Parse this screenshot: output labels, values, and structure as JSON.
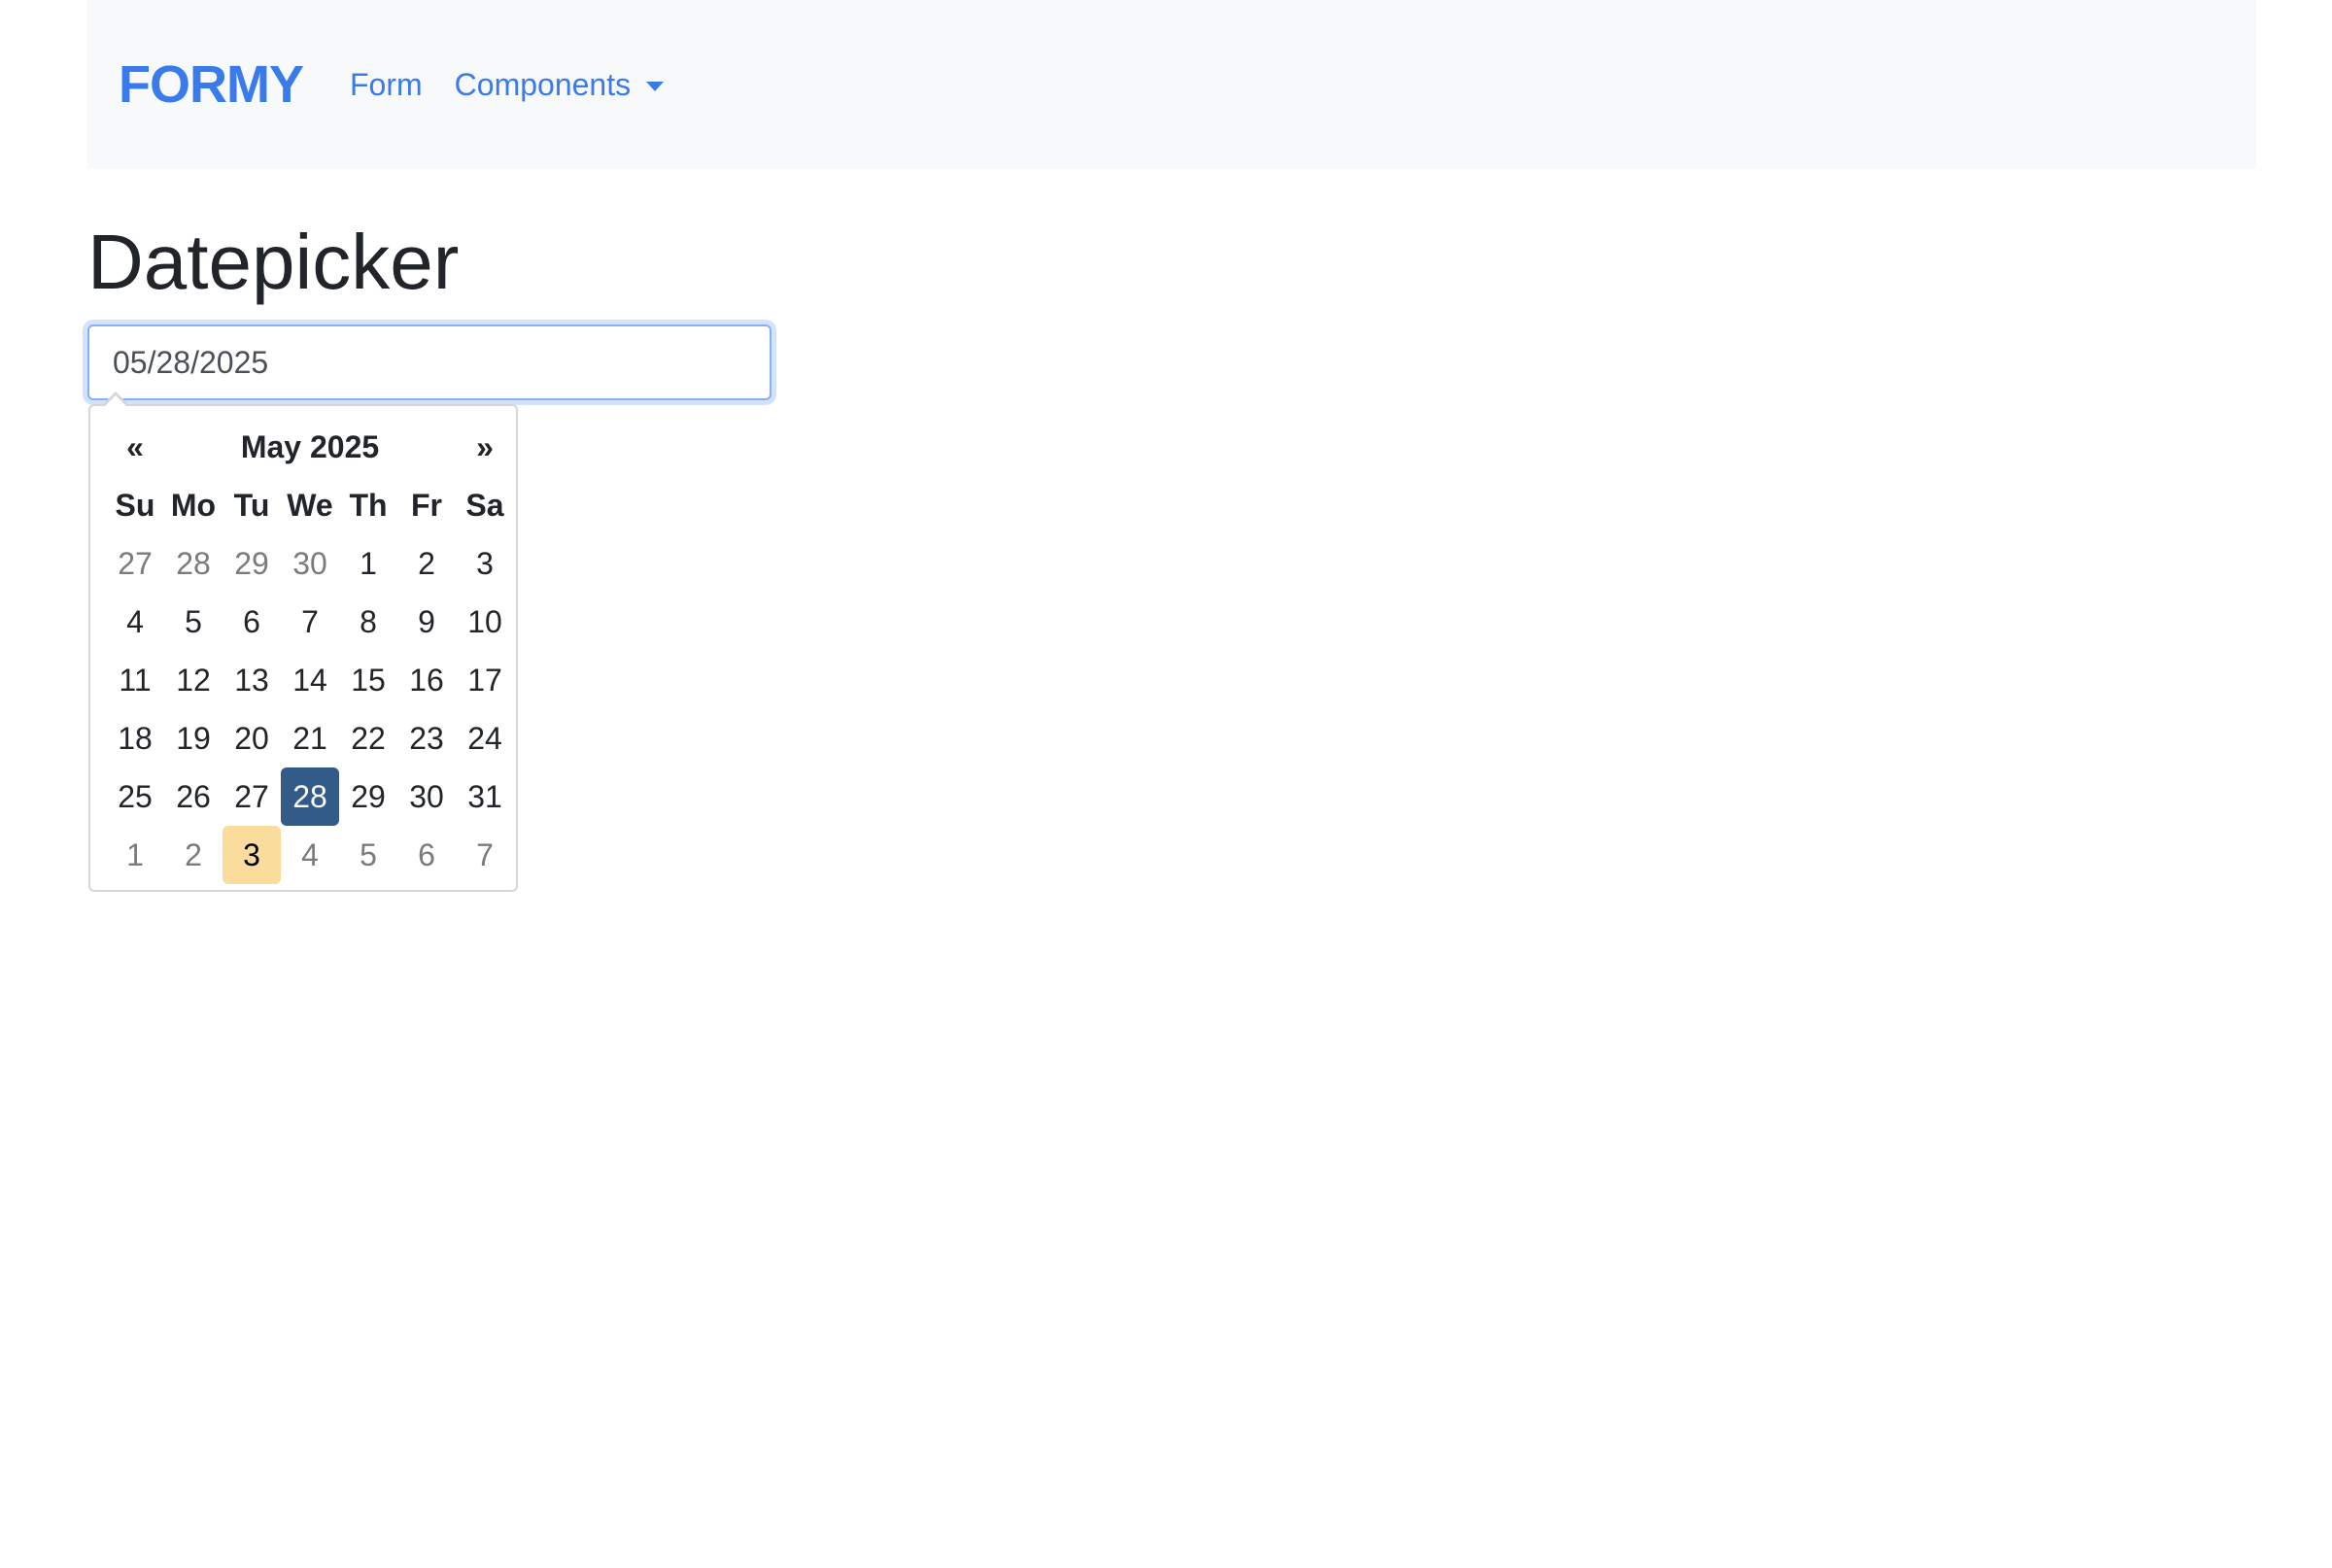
{
  "navbar": {
    "brand": "FORMY",
    "links": [
      {
        "label": "Form"
      },
      {
        "label": "Components"
      }
    ]
  },
  "page": {
    "title": "Datepicker"
  },
  "date_input": {
    "value": "05/28/2025"
  },
  "datepicker": {
    "prev": "«",
    "next": "»",
    "month_label": "May 2025",
    "weekdays": [
      "Su",
      "Mo",
      "Tu",
      "We",
      "Th",
      "Fr",
      "Sa"
    ],
    "weeks": [
      [
        {
          "d": "27",
          "m": true
        },
        {
          "d": "28",
          "m": true
        },
        {
          "d": "29",
          "m": true
        },
        {
          "d": "30",
          "m": true
        },
        {
          "d": "1"
        },
        {
          "d": "2"
        },
        {
          "d": "3"
        }
      ],
      [
        {
          "d": "4"
        },
        {
          "d": "5"
        },
        {
          "d": "6"
        },
        {
          "d": "7"
        },
        {
          "d": "8"
        },
        {
          "d": "9"
        },
        {
          "d": "10"
        }
      ],
      [
        {
          "d": "11"
        },
        {
          "d": "12"
        },
        {
          "d": "13"
        },
        {
          "d": "14"
        },
        {
          "d": "15"
        },
        {
          "d": "16"
        },
        {
          "d": "17"
        }
      ],
      [
        {
          "d": "18"
        },
        {
          "d": "19"
        },
        {
          "d": "20"
        },
        {
          "d": "21"
        },
        {
          "d": "22"
        },
        {
          "d": "23"
        },
        {
          "d": "24"
        }
      ],
      [
        {
          "d": "25"
        },
        {
          "d": "26"
        },
        {
          "d": "27"
        },
        {
          "d": "28",
          "active": true
        },
        {
          "d": "29"
        },
        {
          "d": "30"
        },
        {
          "d": "31"
        }
      ],
      [
        {
          "d": "1",
          "m": true
        },
        {
          "d": "2",
          "m": true
        },
        {
          "d": "3",
          "m": true,
          "today": true
        },
        {
          "d": "4",
          "m": true
        },
        {
          "d": "5",
          "m": true
        },
        {
          "d": "6",
          "m": true
        },
        {
          "d": "7",
          "m": true
        }
      ]
    ],
    "colors": {
      "selected": "#335b8a",
      "today": "#fadd9c"
    }
  }
}
